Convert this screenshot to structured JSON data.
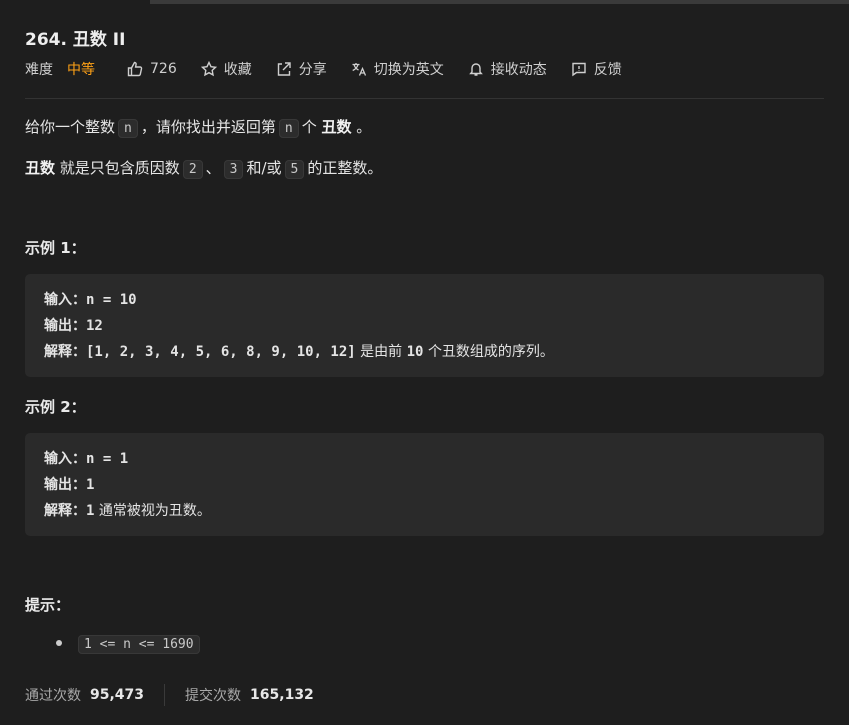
{
  "title": "264. 丑数 II",
  "meta": {
    "difficulty_label": "难度",
    "difficulty": "中等",
    "likes": "726",
    "collect": "收藏",
    "share": "分享",
    "switch_lang": "切换为英文",
    "notify": "接收动态",
    "feedback": "反馈"
  },
  "desc": {
    "l1_a": "给你一个整数",
    "l1_code": "n",
    "l1_b": "，请你找出并返回第",
    "l1_code2": "n",
    "l1_c": "个",
    "l1_bold": "丑数",
    "l1_d": "。",
    "l2_bold": "丑数",
    "l2_a": "就是只包含质因数",
    "l2_c1": "2",
    "l2_b": "、",
    "l2_c2": "3",
    "l2_c": "和/或",
    "l2_c3": "5",
    "l2_d": "的正整数。"
  },
  "example1": {
    "heading": "示例 1：",
    "in_label": "输入：",
    "in_val": "n = 10",
    "out_label": "输出：",
    "out_val": "12",
    "exp_label": "解释：",
    "exp_code": "[1, 2, 3, 4, 5, 6, 8, 9, 10, 12]",
    "exp_a": "是由前",
    "exp_num": "10",
    "exp_b": "个丑数组成的序列。"
  },
  "example2": {
    "heading": "示例 2：",
    "in_label": "输入：",
    "in_val": "n = 1",
    "out_label": "输出：",
    "out_val": "1",
    "exp_label": "解释：",
    "exp_num": "1",
    "exp_text": "通常被视为丑数。"
  },
  "hints": {
    "heading": "提示：",
    "item": "1 <= n <= 1690"
  },
  "stats": {
    "pass_label": "通过次数",
    "pass_val": "95,473",
    "submit_label": "提交次数",
    "submit_val": "165,132"
  },
  "colors": {
    "accent": "#ffa116",
    "bg": "#1e1e1e",
    "code_bg": "#2a2a2a"
  }
}
